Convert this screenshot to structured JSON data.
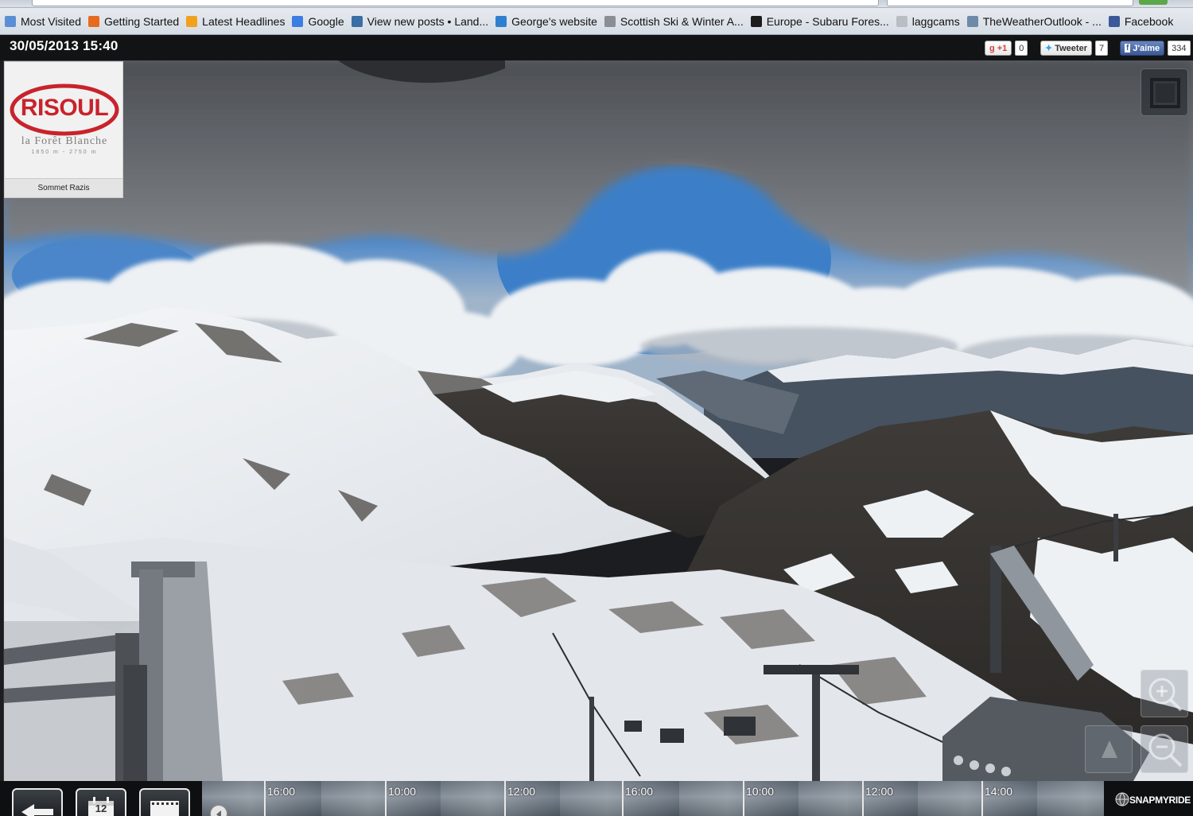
{
  "browser": {
    "bookmarks": [
      {
        "label": "Most Visited",
        "icon": "firefox-page-icon",
        "color": "#5a8fd6"
      },
      {
        "label": "Getting Started",
        "icon": "firefox-logo-icon",
        "color": "#e66b1e"
      },
      {
        "label": "Latest Headlines",
        "icon": "rss-feed-icon",
        "color": "#f0a21e"
      },
      {
        "label": "Google",
        "icon": "google-icon",
        "color": "#3b7de0"
      },
      {
        "label": "View new posts • Land...",
        "icon": "forum-icon",
        "color": "#3a6ea5"
      },
      {
        "label": "George's website",
        "icon": "globe-icon",
        "color": "#2f7fd0"
      },
      {
        "label": "Scottish Ski & Winter A...",
        "icon": "ski-icon",
        "color": "#8a8f96"
      },
      {
        "label": "Europe - Subaru Fores...",
        "icon": "subaru-forum-icon",
        "color": "#1c1c1c"
      },
      {
        "label": "laggcams",
        "icon": "blank-page-icon",
        "color": "#b9bec4"
      },
      {
        "label": "TheWeatherOutlook - ...",
        "icon": "twotlook-icon",
        "color": "#6d8aa8"
      },
      {
        "label": "Facebook",
        "icon": "facebook-icon",
        "color": "#3b5998"
      }
    ]
  },
  "header": {
    "datetime": "30/05/2013 15:40",
    "social": {
      "gplus_label": "+1",
      "gplus_count": "0",
      "twitter_label": "Tweeter",
      "twitter_count": "7",
      "facebook_label": "J'aime",
      "facebook_count": "334"
    }
  },
  "logo": {
    "brand": "RISOUL",
    "tagline": "la Forêt Blanche",
    "altitude": "1850 m - 2750 m",
    "location": "Sommet Razis",
    "brand_color": "#c8232c"
  },
  "timeline": {
    "labels": [
      "16:00",
      "10:00",
      "12:00",
      "16:00",
      "10:00",
      "12:00",
      "14:00"
    ],
    "calendar_day": "12"
  },
  "footer": {
    "provider": "SNAPMYRIDE"
  }
}
